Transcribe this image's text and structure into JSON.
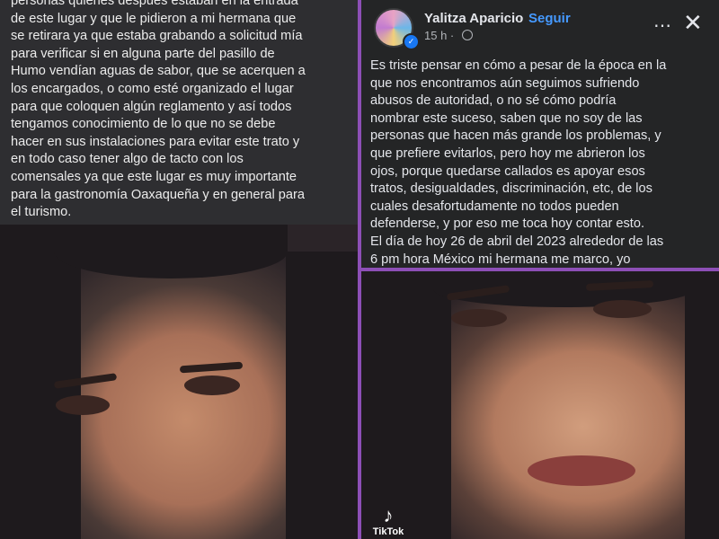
{
  "left_panel": {
    "text": "personas quienes después estaban en la entrada\nde este lugar y que le pidieron a mi hermana que\nse retirara ya que estaba grabando a solicitud mía\npara verificar si en alguna parte del pasillo de\nHumo vendían aguas de sabor, que se acerquen a\nlos encargados, o como esté organizado el lugar\npara que coloquen algún reglamento y así todos\ntengamos conocimiento de lo que no se debe\nhacer en sus instalaciones para evitar este trato y\nen todo caso tener algo de tacto con los\ncomensales ya que este lugar es muy importante\npara la gastronomía Oaxaqueña y en general para\nel turismo."
  },
  "post": {
    "author": "Yalitza Aparicio",
    "separator": "·",
    "follow_label": "Seguir",
    "time": "15 h ·",
    "more_icon": "⋯",
    "close_icon": "✕",
    "body": "Es triste pensar en cómo a pesar de la época en la\nque nos encontramos aún seguimos sufriendo\nabusos de autoridad, o no sé cómo podría\nnombrar este suceso, saben que no soy de las\npersonas que hacen más grande los problemas, y\nque prefiere evitarlos, pero hoy me abrieron los\nojos, porque quedarse callados es apoyar esos\ntratos, desigualdades, discriminación, etc, de los\ncuales desafortudamente no todos pueden\ndefenderse, y por eso me toca hoy contar esto.\nEl día de hoy 26 de abril del 2023 alrededor de las\n6 pm hora México mi hermana me marco, yo"
  },
  "watermark": {
    "logo": "♪",
    "label": "TikTok"
  },
  "colors": {
    "divider": "#8d4fb6",
    "post_bg": "#242526",
    "left_bg": "#2e2e31",
    "follow": "#4599ff"
  }
}
